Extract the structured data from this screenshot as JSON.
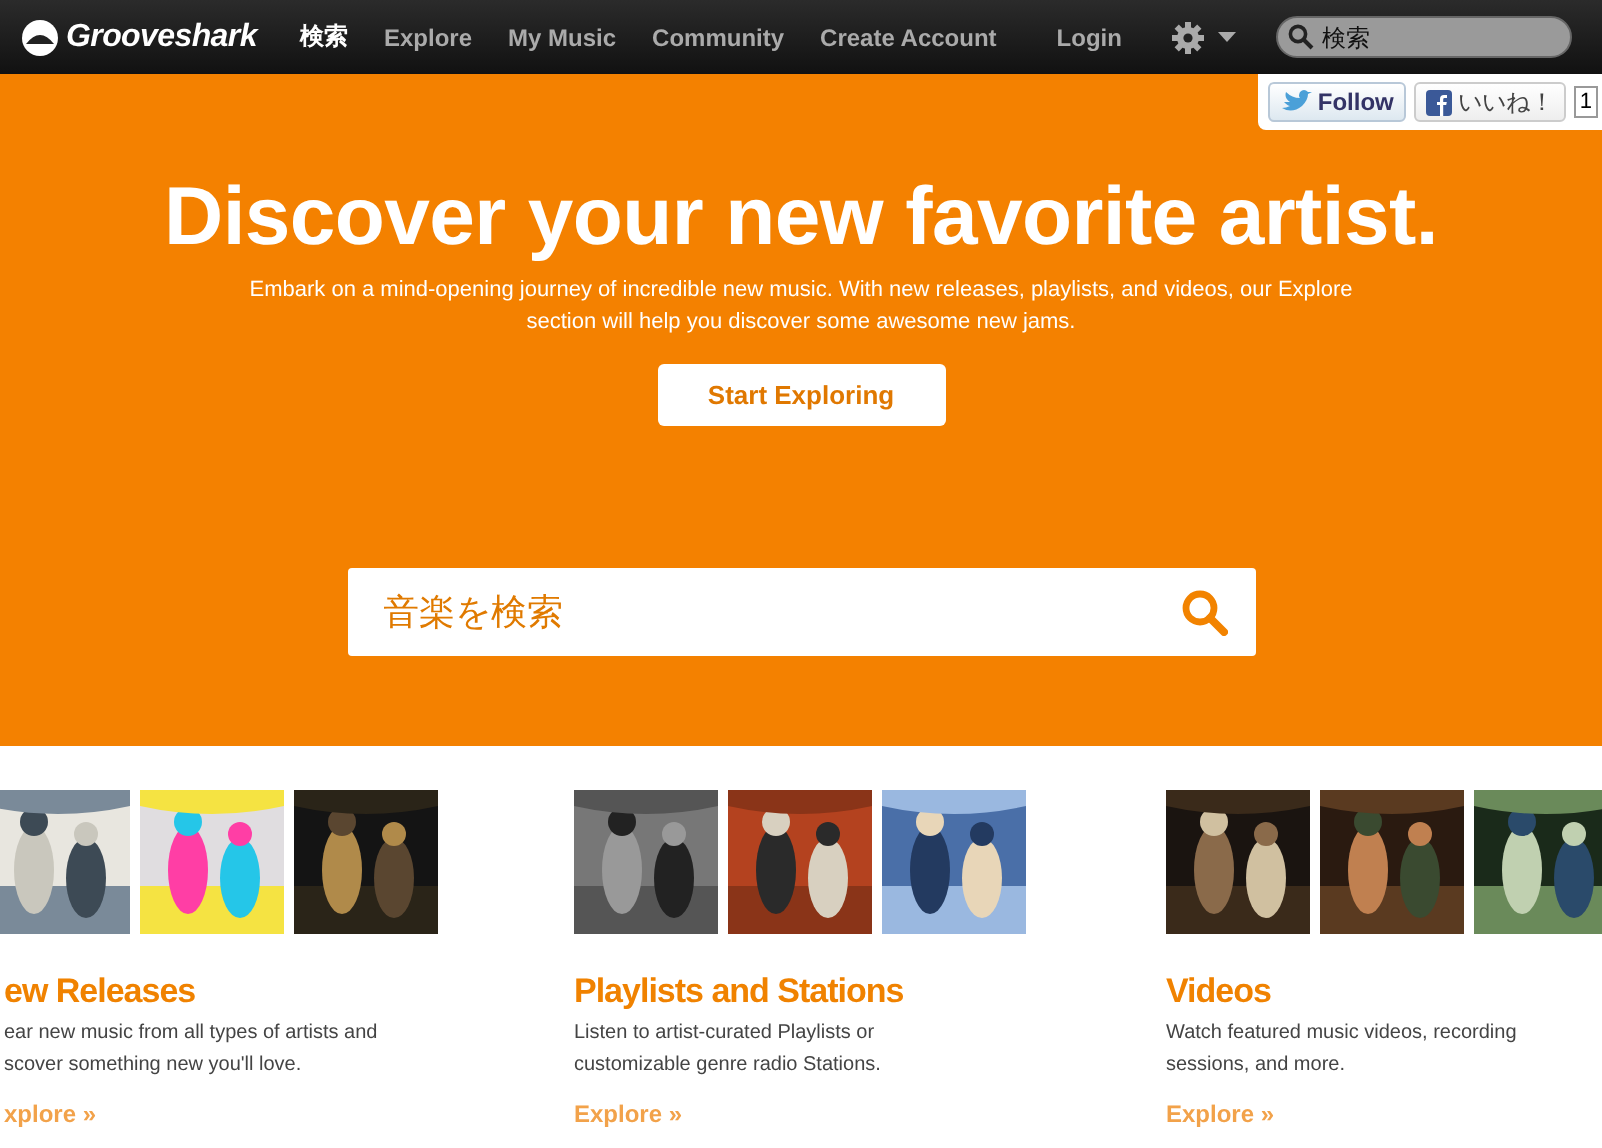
{
  "nav": {
    "logo": "Grooveshark",
    "items": [
      {
        "label": "検索",
        "selected": true
      },
      {
        "label": "Explore",
        "selected": false
      },
      {
        "label": "My Music",
        "selected": false
      },
      {
        "label": "Community",
        "selected": false
      },
      {
        "label": "Create Account",
        "selected": false
      },
      {
        "label": "Login",
        "selected": false
      }
    ],
    "search": {
      "placeholder": "検索"
    }
  },
  "social": {
    "follow": "Follow",
    "like": "いいね！",
    "count": "1"
  },
  "hero": {
    "title": "Discover your new favorite artist.",
    "subtitle": "Embark on a mind-opening journey of incredible new music. With new releases, playlists, and videos, our Explore section will help you discover some awesome new jams.",
    "button": "Start Exploring",
    "search": {
      "placeholder": "音楽を検索"
    }
  },
  "sections": [
    {
      "title": "ew Releases",
      "lines": [
        "ear new music from all types of artists and",
        "scover something new you'll love."
      ],
      "link": "xplore »",
      "thumbs": [
        {
          "kind": "picture"
        },
        {
          "kind": "picture"
        },
        {
          "kind": "picture"
        }
      ]
    },
    {
      "title": "Playlists and Stations",
      "lines": [
        "Listen to artist-curated Playlists or",
        "customizable genre radio Stations."
      ],
      "link": "Explore »",
      "thumbs": [
        {
          "kind": "picture"
        },
        {
          "kind": "picture"
        },
        {
          "kind": "picture"
        }
      ]
    },
    {
      "title": "Videos",
      "lines": [
        "Watch featured music videos, recording",
        "sessions, and more."
      ],
      "link": "Explore »",
      "thumbs": [
        {
          "kind": "picture"
        },
        {
          "kind": "picture"
        },
        {
          "kind": "picture"
        }
      ]
    }
  ]
}
